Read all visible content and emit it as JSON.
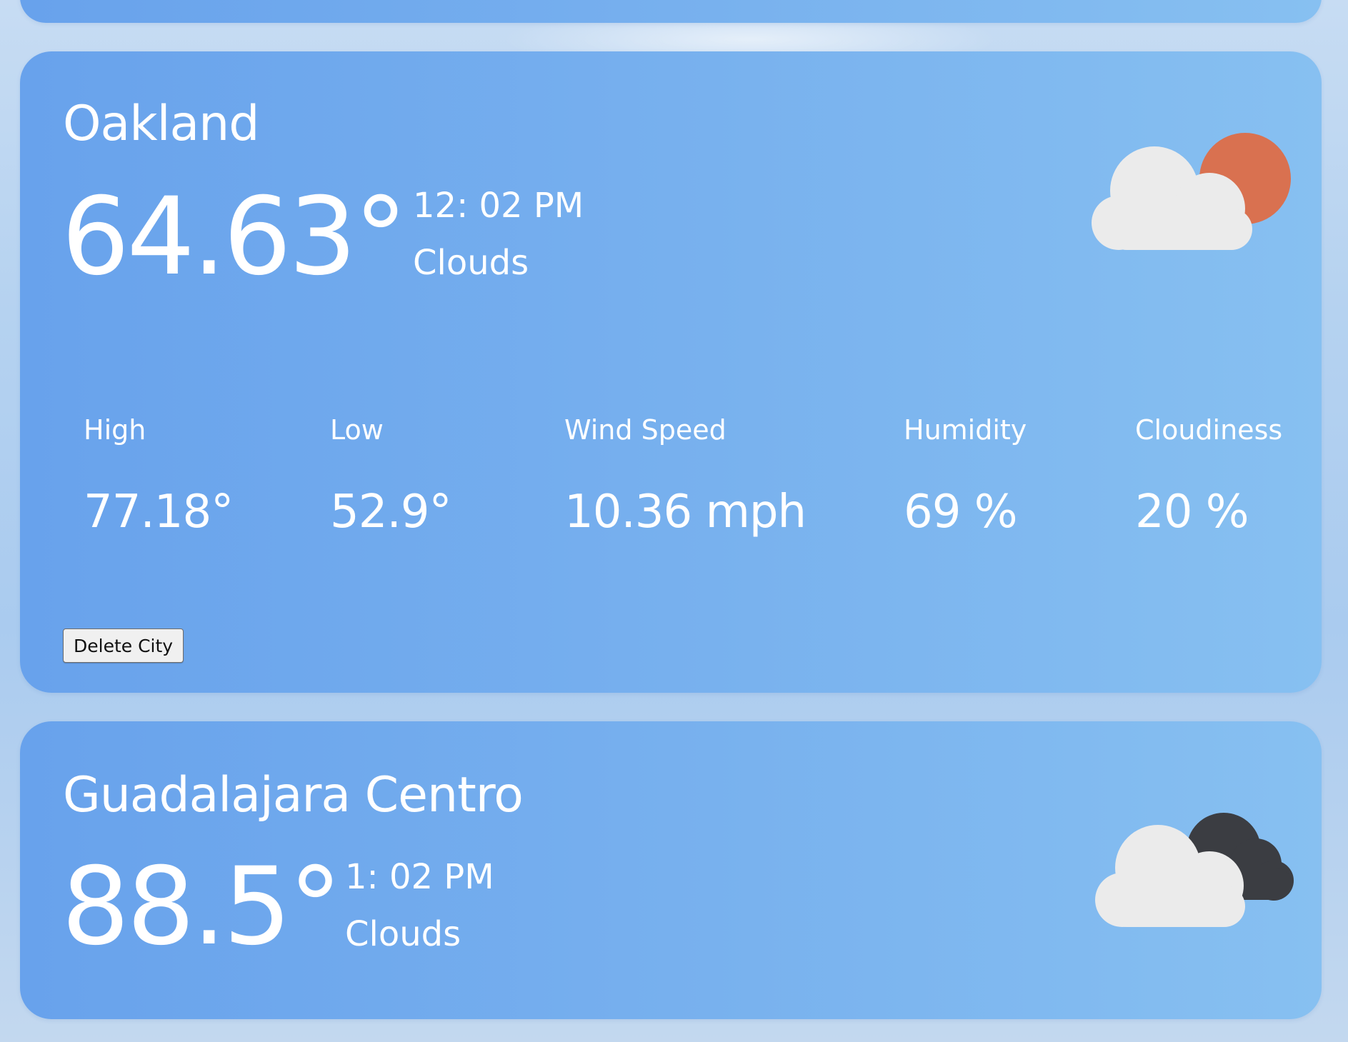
{
  "cities": [
    {
      "name": "Oakland",
      "temperature": "64.63°",
      "time": "12: 02 PM",
      "condition": "Clouds",
      "icon": "cloud-sun-icon",
      "stats": {
        "high": {
          "label": "High",
          "value": "77.18°"
        },
        "low": {
          "label": "Low",
          "value": "52.9°"
        },
        "wind": {
          "label": "Wind Speed",
          "value": "10.36 mph"
        },
        "humidity": {
          "label": "Humidity",
          "value": "69 %"
        },
        "cloudiness": {
          "label": "Cloudiness",
          "value": "20 %"
        }
      },
      "delete_label": "Delete City"
    },
    {
      "name": "Guadalajara Centro",
      "temperature": "88.5°",
      "time": "1: 02 PM",
      "condition": "Clouds",
      "icon": "cloud-dark-cloud-icon"
    }
  ],
  "colors": {
    "card_start": "#68a2ec",
    "card_end": "#87c0f1",
    "sun": "#d97150",
    "cloud_light": "#ebebeb",
    "cloud_dark": "#3b3d42"
  }
}
